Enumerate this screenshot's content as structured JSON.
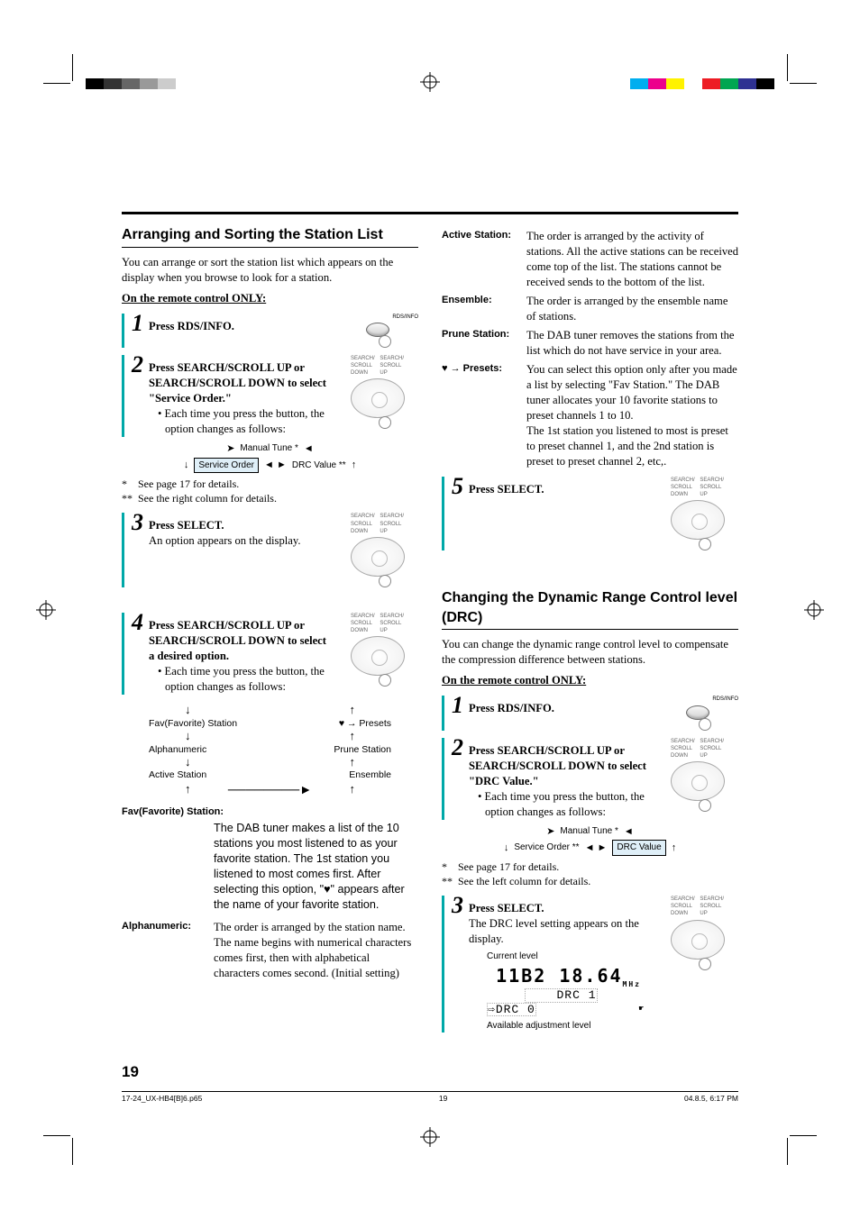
{
  "page_number": "19",
  "footer": {
    "file": "17-24_UX-HB4[B]6.p65",
    "pg": "19",
    "date": "04.8.5, 6:17 PM"
  },
  "color_bars_left": [
    "#000000",
    "#333333",
    "#666666",
    "#999999",
    "#cccccc",
    "#ffffff",
    "#ffffff",
    "#ffffff"
  ],
  "color_bars_right": [
    "#00aeef",
    "#ec008c",
    "#fff200",
    "#ffffff",
    "#ed1c24",
    "#00a651",
    "#2e3192",
    "#000000"
  ],
  "left": {
    "heading": "Arranging and Sorting the Station List",
    "intro": "You can arrange or sort the station list which appears on the display when you browse to look for a station.",
    "remote_only": "On the remote control ONLY:",
    "btn_rds": "RDS/INFO",
    "btn_scroll_down": "SEARCH/ SCROLL DOWN",
    "btn_scroll_up": "SEARCH/ SCROLL UP",
    "step1": "Press RDS/INFO.",
    "step2_title": "Press SEARCH/SCROLL UP or SEARCH/SCROLL DOWN to select \"Service Order.\"",
    "step2_bullet": "• Each time you press the button, the option changes as follows:",
    "cycle_manual": "Manual Tune",
    "cycle_service": "Service Order",
    "cycle_drc": "DRC Value",
    "note1": "* See page 17 for details.",
    "note2": "** See the right column for details.",
    "step3_title": "Press SELECT.",
    "step3_body": "An option appears on the display.",
    "step4_title": "Press SEARCH/SCROLL UP or SEARCH/SCROLL DOWN to select a desired option.",
    "step4_bullet": "• Each time you press the button, the option changes as follows:",
    "flow": {
      "fav": "Fav(Favorite) Station",
      "presets": "♥ → Presets",
      "alpha": "Alphanumeric",
      "prune": "Prune Station",
      "active": "Active Station",
      "ensemble": "Ensemble"
    },
    "defs": {
      "fav_term": "Fav(Favorite) Station:",
      "fav_desc": "The DAB tuner makes a list of the 10 stations you most listened to as your favorite station. The 1st station you listened to most comes first. After selecting this option, \"♥\" appears after the name of your favorite station.",
      "alpha_term": "Alphanumeric:",
      "alpha_desc": "The order is arranged by the station name. The name begins with numerical characters comes first, then with alphabetical characters comes second. (Initial setting)"
    }
  },
  "right": {
    "defs": {
      "active_term": "Active Station:",
      "active_desc": "The order is arranged by the activity of stations. All the active stations can be received come top of the list. The stations cannot be received sends to the bottom of the list.",
      "ens_term": "Ensemble:",
      "ens_desc": "The order is arranged by the ensemble name of stations.",
      "prune_term": "Prune Station:",
      "prune_desc": "The DAB tuner removes the stations from the list which do not have service in your area.",
      "presets_term": "♥ → Presets:",
      "presets_desc": "You can select this option only after you made a list by selecting \"Fav Station.\" The DAB tuner allocates your 10 favorite stations to preset channels 1 to 10.\nThe 1st station you listened to most is preset to preset channel 1, and the 2nd station is preset to preset channel 2, etc,."
    },
    "step5": "Press SELECT.",
    "drc_heading": "Changing the Dynamic Range Control level (DRC)",
    "drc_intro": "You can change the dynamic range control level to compensate the compression difference between stations.",
    "remote_only": "On the remote control ONLY:",
    "drc_step1": "Press RDS/INFO.",
    "drc_step2_title": "Press SEARCH/SCROLL UP or SEARCH/SCROLL DOWN to select \"DRC Value.\"",
    "drc_step2_bullet": "• Each time you press the button, the option changes as follows:",
    "drc_note1": "* See page 17 for details.",
    "drc_note2": "** See the left column for details.",
    "drc_step3_title": "Press SELECT.",
    "drc_step3_body": "The DRC level setting appears on the display.",
    "lcd_current": "Current level",
    "lcd_freq": "11B2 18.64",
    "lcd_line1": "DRC 1",
    "lcd_line2": "⇨DRC 0",
    "lcd_avail": "Available adjustment level"
  }
}
